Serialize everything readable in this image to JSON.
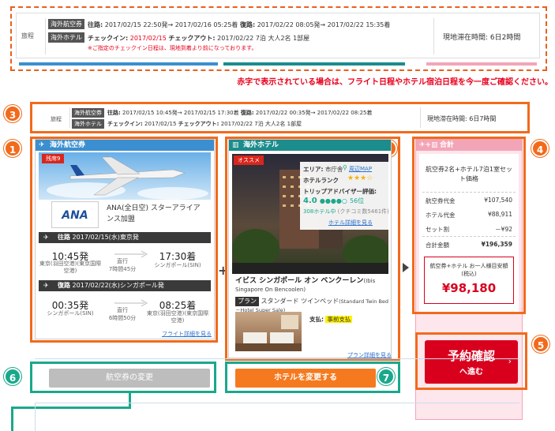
{
  "top_summary": {
    "travel_label": "旅程",
    "flight_tag": "海外航空券",
    "flight_text_out_label": "往路:",
    "flight_text_out": "2017/02/15 22:50発→ 2017/02/16 05:25着",
    "flight_text_in_label": "復路:",
    "flight_text_in": "2017/02/22 08:05発→ 2017/02/22 15:35着",
    "hotel_tag": "海外ホテル",
    "checkin_label": "チェックイン:",
    "checkin_value": "2017/02/15",
    "checkout_label": "チェックアウト:",
    "checkout_value": "2017/02/22 7泊 大人2名 1部屋",
    "warning": "※ご指定のチェックイン日程は、現地到着より前になっております。",
    "stay_label": "現地滞在時間:",
    "stay_value": "6日2時間"
  },
  "notice": "赤字で表示されている場合は、フライト日程やホテル宿泊日程を今一度ご確認ください。",
  "mid_summary": {
    "travel_label": "旅程",
    "flight_tag": "海外航空券",
    "flight_text_out_label": "往路:",
    "flight_text_out": "2017/02/15 10:45発→ 2017/02/15 17:30着",
    "flight_text_in_label": "復路:",
    "flight_text_in": "2017/02/22 00:35発→ 2017/02/22 08:25着",
    "hotel_tag": "海外ホテル",
    "checkin_label": "チェックイン:",
    "checkin_value": "2017/02/15",
    "checkout_label": "チェックアウト:",
    "checkout_value": "2017/02/22 7泊 大人2名 1部屋",
    "stay_label": "現地滞在時間:",
    "stay_value": "6日7時間"
  },
  "markers": [
    "1",
    "2",
    "3",
    "4",
    "5",
    "6",
    "7"
  ],
  "flight_card": {
    "header": "海外航空券",
    "remaining_badge": "残席9",
    "airline_logo": "ANA",
    "airline_name": "ANA(全日空) スターアライアンス加盟",
    "outbound_label": "往路",
    "outbound_header": "2017/02/15(水)東京発",
    "outbound_dep_time": "10:45発",
    "outbound_dep_place": "東京(羽田空港)(東京国際空港)",
    "outbound_direct": "直行",
    "outbound_duration": "7時間45分",
    "outbound_arr_time": "17:30着",
    "outbound_arr_place": "シンガポール(SIN)",
    "inbound_label": "復路",
    "inbound_header": "2017/02/22(水)シンガポール発",
    "inbound_dep_time": "00:35発",
    "inbound_dep_place": "シンガポール(SIN)",
    "inbound_direct": "直行",
    "inbound_duration": "6時間50分",
    "inbound_arr_time": "08:25着",
    "inbound_arr_place": "東京(羽田空港)(東京国際空港)",
    "details_link": "フライト詳細を見る",
    "change_button": "航空券の変更"
  },
  "hotel_card": {
    "header": "海外ホテル",
    "recommend_badge": "オススメ",
    "area_label": "エリア:",
    "area_value": "市庁舎",
    "map_link": "周辺MAP",
    "rank_label": "ホテルランク",
    "stars": 3.5,
    "stars_text": "★★★☆",
    "trip_label": "トリップアドバイザー評価:",
    "trip_score": "4.0",
    "trip_rank": "56位",
    "trip_rank_of": "308ホテル中",
    "trip_reviews": "(クチコミ数5461件)",
    "hotel_details_link": "ホテル詳細を見る",
    "hotel_name": "イビス シンガポール オン ベンクーレン",
    "hotel_name_en": "(Ibis Singapore On Bencoolen)",
    "plan_tag": "プラン",
    "plan_name": "スタンダード ツインベッド",
    "plan_name_en": "(Standard Twin Bed－Hotel Super Sale)",
    "payment_label": "支払:",
    "payment_value": "事前支払",
    "plan_link": "プラン詳細を見る",
    "change_button": "ホテルを変更する"
  },
  "total_card": {
    "header": "合計",
    "summary_title": "航空券2名+ホテル7泊1室セット価格",
    "rows": [
      {
        "label": "航空券代金",
        "value": "¥107,540"
      },
      {
        "label": "ホテル代金",
        "value": "¥88,911"
      },
      {
        "label": "セット割",
        "value": "－¥92"
      }
    ],
    "total_label": "合計金額",
    "total_value": "¥196,359",
    "per_person_title": "航空券+ホテル お一人様目安額(税込)",
    "per_person_value": "¥98,180",
    "reserve_main": "予約確認",
    "reserve_sub": "へ進む"
  },
  "colors": {
    "accent_orange": "#f26a1b",
    "accent_green": "#1aa88c",
    "flight_blue": "#3b8fd0",
    "hotel_teal": "#1c8c8c",
    "total_pink": "#f3a5b8",
    "alert_red": "#e8001c"
  },
  "icons": [
    "plane-icon",
    "hotel-icon",
    "calculator-icon",
    "map-pin-icon",
    "chevron-right-icon",
    "plus-icon",
    "arrow-right-icon"
  ]
}
